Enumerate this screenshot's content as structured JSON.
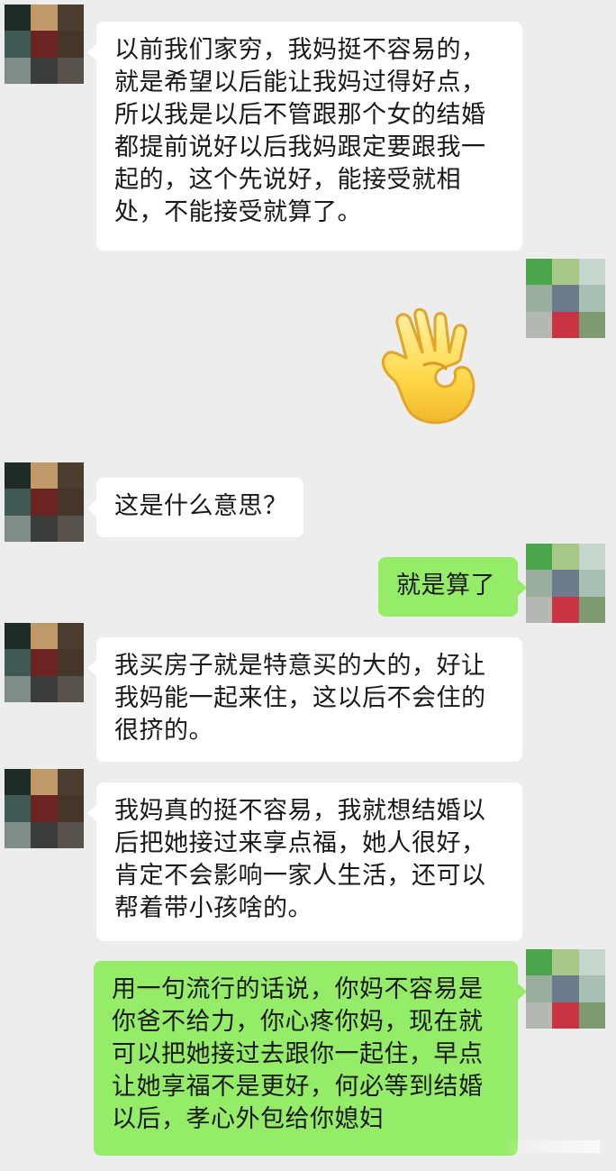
{
  "messages": [
    {
      "side": "left",
      "lines": [
        "以前我们家穷，我妈挺不容易的，",
        "就是希望以后能让我妈过得好点，",
        "所以我是以后不管跟那个女的结婚",
        "都提前说好以后我妈跟定要跟我一",
        "起的，这个先说好，能接受就相",
        "处，不能接受就算了。"
      ]
    },
    {
      "side": "right",
      "sticker": "ok-hand-emoji"
    },
    {
      "side": "left",
      "lines": [
        "这是什么意思？"
      ]
    },
    {
      "side": "right",
      "lines": [
        "就是算了"
      ]
    },
    {
      "side": "left",
      "lines": [
        "我买房子就是特意买的大的，好让",
        "我妈能一起来住，这以后不会住的",
        "很挤的。"
      ]
    },
    {
      "side": "left",
      "lines": [
        "我妈真的挺不容易，我就想结婚以",
        "后把她接过来享点福，她人很好，",
        "肯定不会影响一家人生活，还可以",
        "帮着带小孩啥的。"
      ]
    },
    {
      "side": "right",
      "lines": [
        "用一句流行的话说，你妈不容易是",
        "你爸不给力，你心疼你妈，现在就",
        "可以把她接过去跟你一起住，早点",
        "让她享福不是更好，何必等到结婚",
        "以后，孝心外包给你媳妇"
      ]
    }
  ],
  "avatars": {
    "left_colors": [
      "#1e2b26",
      "#c09a66",
      "#4b3e2e",
      "#3f5a55",
      "#6b2422",
      "#45352a",
      "#7f8d86",
      "#3a3d3a",
      "#58524a"
    ],
    "right_colors": [
      "#4aa54b",
      "#a6c98a",
      "#c7d6cc",
      "#9aae9e",
      "#6d7a8b",
      "#a8c0b3",
      "#b3b8b2",
      "#c93344",
      "#7d9a70"
    ]
  },
  "colors": {
    "background": "#ededed",
    "left_bubble": "#ffffff",
    "right_bubble": "#95ec69",
    "text": "#191919"
  }
}
